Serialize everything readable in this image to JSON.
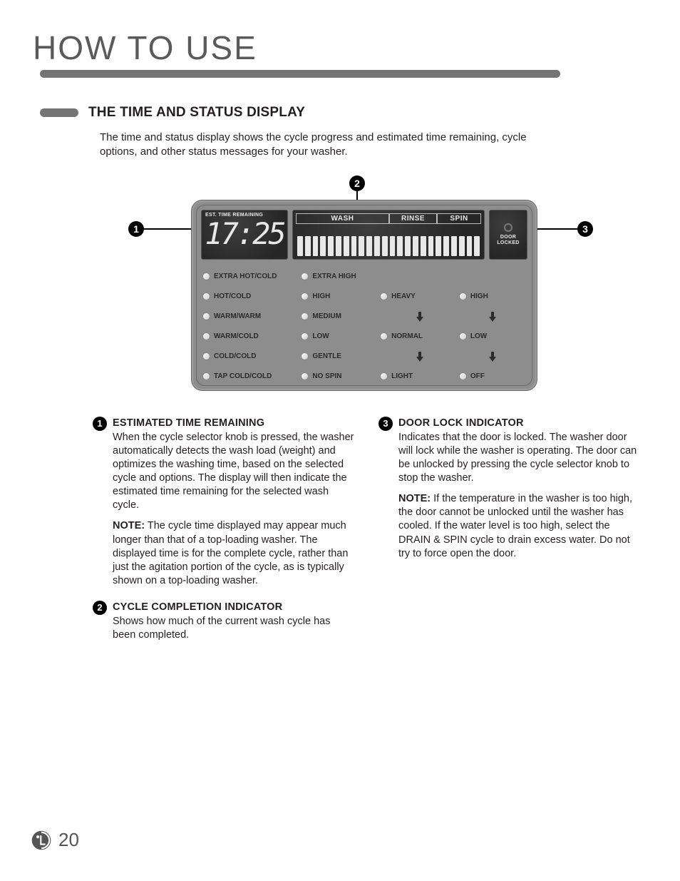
{
  "page_title": "HOW TO USE",
  "section_heading": "THE TIME AND STATUS DISPLAY",
  "intro": "The time and status display shows the cycle progress and estimated time remaining, cycle options, and other status messages for your washer.",
  "callouts": {
    "c1": "1",
    "c2": "2",
    "c3": "3"
  },
  "lcd": {
    "time_label": "EST. TIME REMAINING",
    "time_value": "17:25",
    "phases": {
      "wash": "WASH",
      "rinse": "RINSE",
      "spin": "SPIN"
    },
    "door_label": "DOOR LOCKED"
  },
  "options": {
    "col1": [
      "EXTRA HOT/COLD",
      "HOT/COLD",
      "WARM/WARM",
      "WARM/COLD",
      "COLD/COLD",
      "TAP COLD/COLD"
    ],
    "col2": [
      "EXTRA HIGH",
      "HIGH",
      "MEDIUM",
      "LOW",
      "GENTLE",
      "NO SPIN"
    ],
    "col3": [
      "",
      "HEAVY",
      "",
      "NORMAL",
      "",
      "LIGHT"
    ],
    "col4": [
      "",
      "HIGH",
      "",
      "LOW",
      "",
      "OFF"
    ]
  },
  "items": {
    "i1": {
      "num": "1",
      "title": "ESTIMATED TIME REMAINING",
      "p1": "When the cycle selector knob is pressed, the washer automatically detects the wash load (weight) and optimizes the washing time, based on the selected cycle and options. The display will then indicate the estimated time remaining for the selected wash cycle.",
      "note_label": "NOTE:",
      "p2": "The cycle time displayed may appear much longer than that of a top-loading washer. The displayed time is for the complete cycle, rather than just the agitation portion of the cycle, as is typically shown on a top-loading washer."
    },
    "i2": {
      "num": "2",
      "title": "CYCLE COMPLETION INDICATOR",
      "p1": "Shows how much of the current wash cycle has been completed."
    },
    "i3": {
      "num": "3",
      "title": "DOOR LOCK INDICATOR",
      "p1": "Indicates that the door is locked. The washer door will lock while the washer is operating. The door can be unlocked by pressing the cycle selector knob to stop the washer.",
      "note_label": "NOTE:",
      "p2": "If the temperature in the washer is too high, the door cannot be unlocked until the washer has cooled. If the water level is too high, select the DRAIN & SPIN cycle to drain excess water. Do not try to force open the door."
    }
  },
  "page_number": "20"
}
